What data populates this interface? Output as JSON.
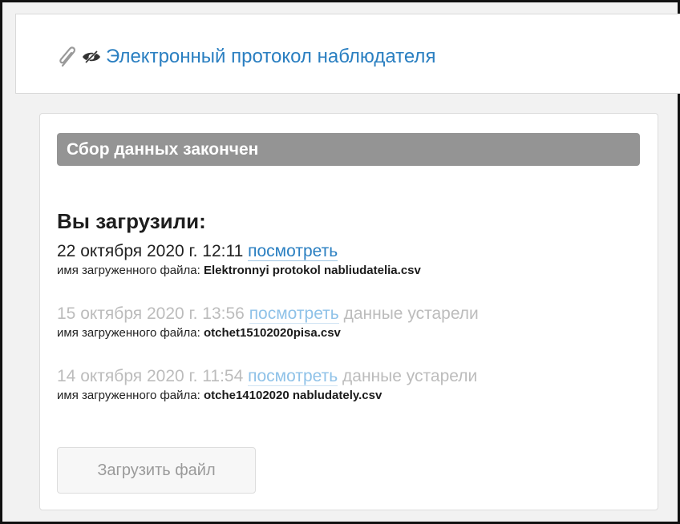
{
  "protocol": {
    "icons": [
      "paperclip-icon",
      "hidden-eye-icon"
    ],
    "link_text": "Электронный протокол наблюдателя"
  },
  "status": {
    "text": "Сбор данных закончен"
  },
  "uploads": {
    "heading": "Вы загрузили:",
    "file_name_label": "имя загруженного файла:",
    "view_label": "посмотреть",
    "items": [
      {
        "date": "22 октября 2020 г. 12:11",
        "note": "",
        "file_name": "Elektronnyi protokol nabliudatelia.csv"
      },
      {
        "date": "15 октября 2020 г. 13:56",
        "note": "данные устарели",
        "file_name": "otchet15102020pisa.csv"
      },
      {
        "date": "14 октября 2020 г. 11:54",
        "note": "данные устарели",
        "file_name": "otche14102020 nabludately.csv"
      }
    ]
  },
  "actions": {
    "upload_button": "Загрузить файл"
  },
  "colors": {
    "link": "#2a7fc1",
    "status_bar": "#949494",
    "outdated_text": "#bcbcbc"
  }
}
